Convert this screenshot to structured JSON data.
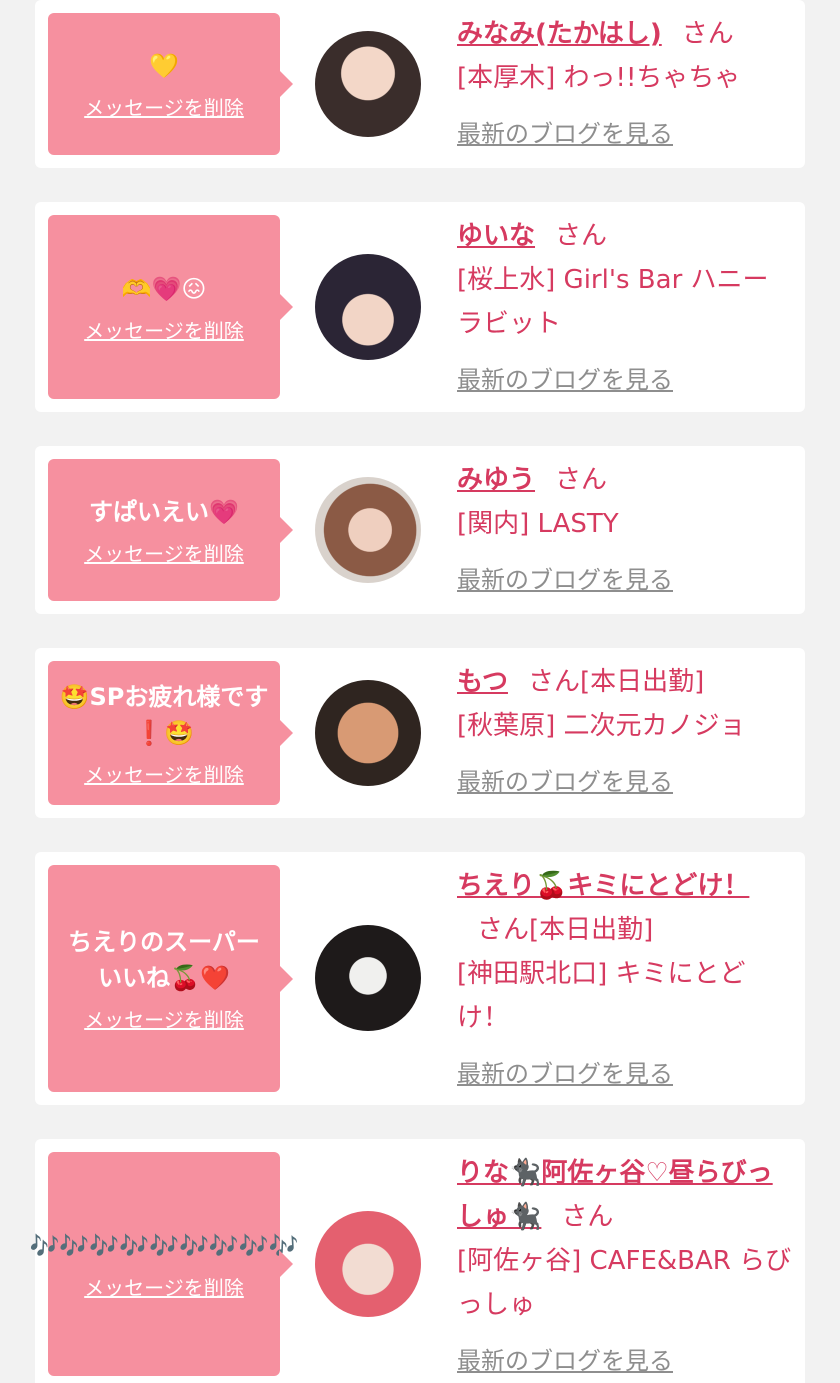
{
  "labels": {
    "delete": "メッセージを削除",
    "blog": "最新のブログを見る",
    "honorific": "さん"
  },
  "cards": [
    {
      "message": "💛",
      "name": "みなみ(たかはし)",
      "status": "",
      "shop": "[本厚木] わっ!!ちゃちゃ"
    },
    {
      "message": "🫶💗😖",
      "name": "ゆいな",
      "status": "",
      "shop": "[桜上水] Girl's Bar ハニーラビット"
    },
    {
      "message": "すぱいえい💗",
      "name": "みゆう",
      "status": "",
      "shop": "[関内] LASTY"
    },
    {
      "message": "🤩SPお疲れ様です❗️🤩",
      "name": "もつ",
      "status": "[本日出勤]",
      "shop": "[秋葉原] 二次元カノジョ"
    },
    {
      "message": "ちえりのスーパーいいね🍒❤️",
      "name": "ちえり🍒キミにとどけ！",
      "status": "[本日出勤]",
      "shop": "[神田駅北口] キミにとどけ！"
    },
    {
      "message": "🎶🎶🎶🎶🎶🎶🎶🎶🎶",
      "name": "りな🐈‍⬛阿佐ヶ谷♡昼らびっしゅ🐈‍⬛",
      "status": "",
      "shop": "[阿佐ヶ谷] CAFE&BAR らびっしゅ"
    }
  ]
}
